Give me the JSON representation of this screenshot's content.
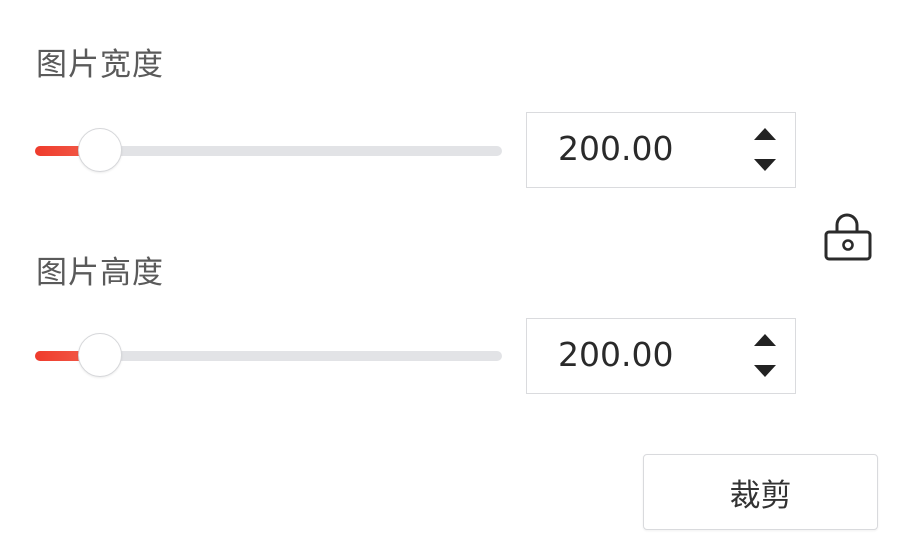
{
  "image_width": {
    "label": "图片宽度",
    "value": "200.00",
    "slider_fraction": 0.14
  },
  "image_height": {
    "label": "图片高度",
    "value": "200.00",
    "slider_fraction": 0.14
  },
  "aspect_lock": {
    "icon": "lock-icon",
    "locked": false
  },
  "crop_button": {
    "label": "裁剪"
  },
  "colors": {
    "accent": "#ef3b2c",
    "track": "#e2e3e6",
    "border": "#dadbde",
    "text": "#333333"
  }
}
